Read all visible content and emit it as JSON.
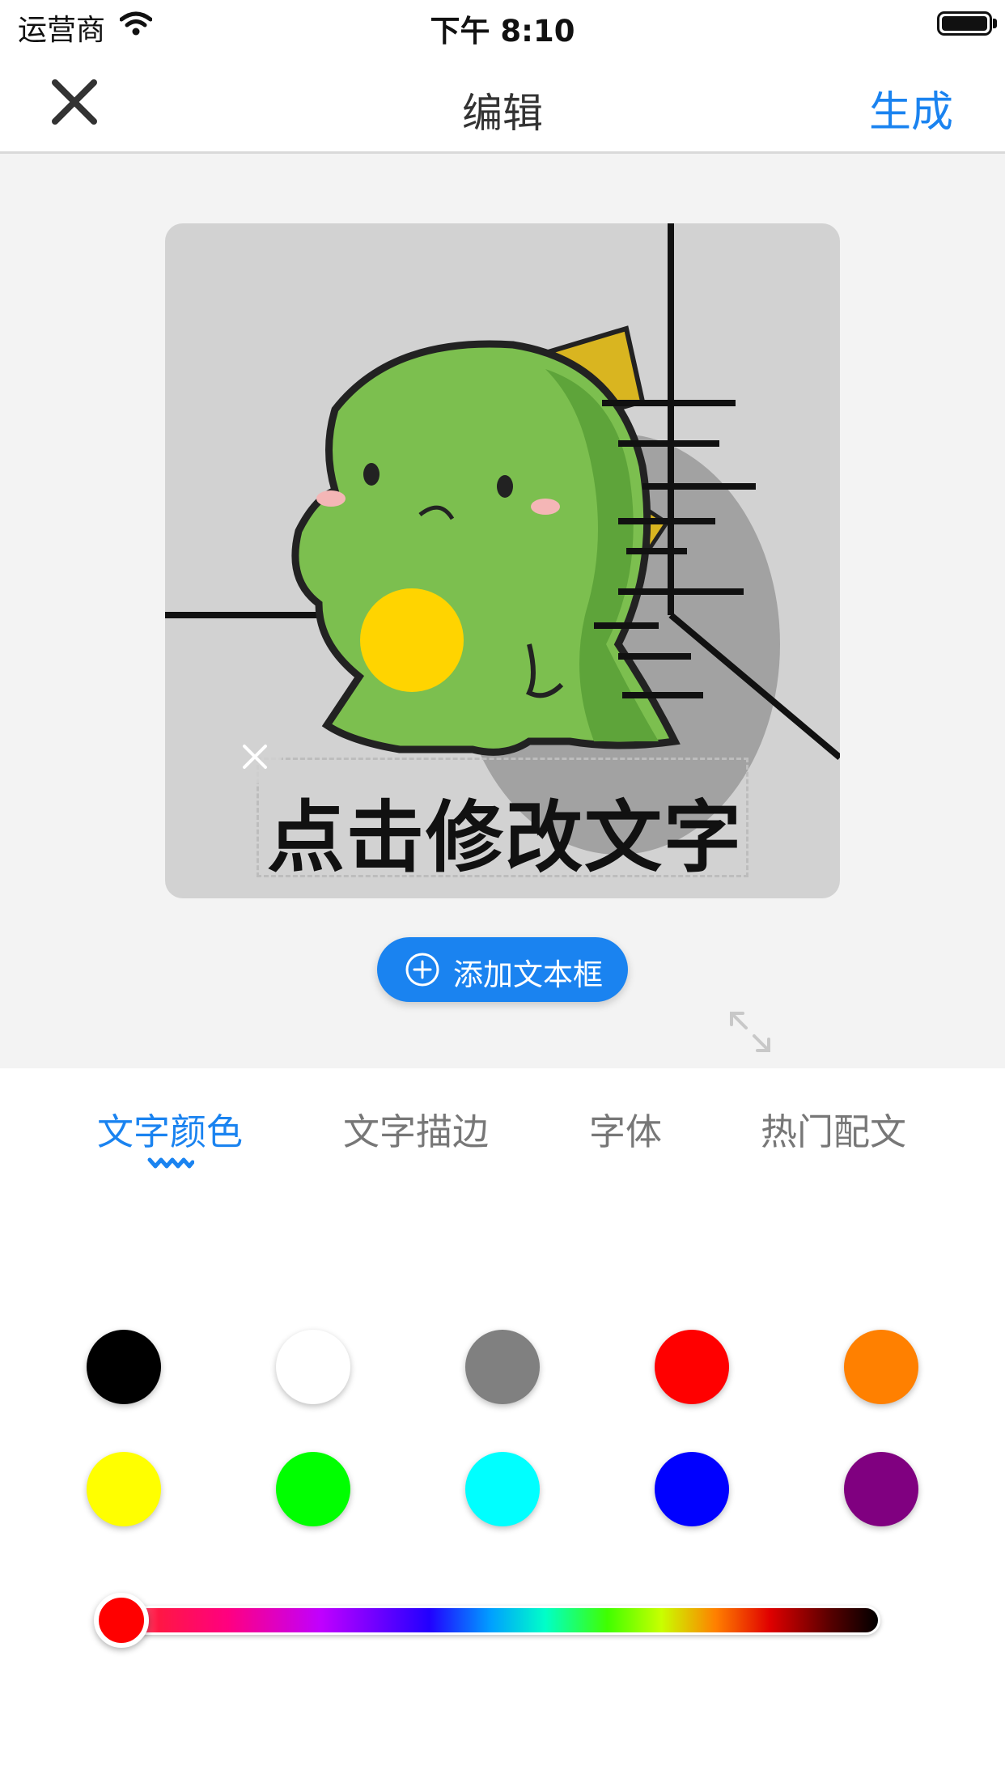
{
  "status_bar": {
    "carrier": "运营商",
    "time": "下午 8:10"
  },
  "nav": {
    "title": "编辑",
    "action_label": "生成",
    "close_icon": "close-icon"
  },
  "canvas": {
    "sticker": "green-dinosaur-sticker",
    "text_placeholder": "点击修改文字"
  },
  "add_text_button": {
    "label": "添加文本框",
    "icon": "plus-circle-icon"
  },
  "tabs": [
    {
      "label": "文字颜色",
      "active": true
    },
    {
      "label": "文字描边",
      "active": false
    },
    {
      "label": "字体",
      "active": false
    },
    {
      "label": "热门配文",
      "active": false
    }
  ],
  "swatches": [
    {
      "name": "black",
      "color": "#000000"
    },
    {
      "name": "white",
      "color": "#ffffff"
    },
    {
      "name": "gray",
      "color": "#808080"
    },
    {
      "name": "red",
      "color": "#ff0000"
    },
    {
      "name": "orange",
      "color": "#ff8000"
    },
    {
      "name": "yellow",
      "color": "#ffff00"
    },
    {
      "name": "green",
      "color": "#00ff00"
    },
    {
      "name": "cyan",
      "color": "#00ffff"
    },
    {
      "name": "blue",
      "color": "#0000ff"
    },
    {
      "name": "purple",
      "color": "#800080"
    }
  ],
  "color_slider": {
    "value": 0,
    "thumb_color": "#ff0000"
  },
  "colors": {
    "accent": "#1a83f0",
    "editor_bg": "#f3f3f3"
  }
}
